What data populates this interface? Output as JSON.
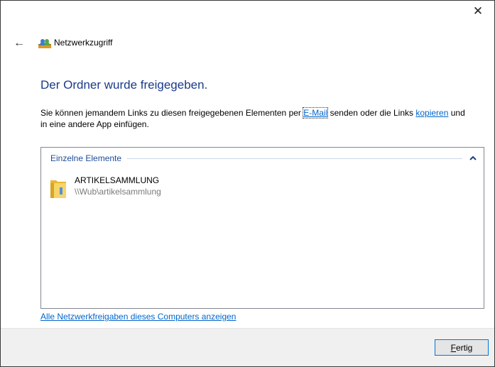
{
  "window": {
    "title": "Netzwerkzugriff",
    "close_glyph": "✕",
    "back_glyph": "←"
  },
  "main": {
    "heading": "Der Ordner wurde freigegeben.",
    "desc_part1": "Sie können jemandem Links zu diesen freigegebenen Elementen per ",
    "email_link": "E-Mail",
    "desc_part2": " senden oder die Links ",
    "copy_link": "kopieren",
    "desc_part3": " und in eine andere App einfügen."
  },
  "list": {
    "group_label": "Einzelne Elemente",
    "chevron": "⌃",
    "items": [
      {
        "name": "ARTIKELSAMMLUNG",
        "path": "\\\\Wub\\artikelsammlung",
        "icon": "folder-icon"
      }
    ]
  },
  "links": {
    "show_all": "Alle Netzwerkfreigaben dieses Computers anzeigen"
  },
  "footer": {
    "done_accel": "F",
    "done_rest": "ertig"
  },
  "colors": {
    "heading": "#1a3a8a",
    "link": "#0066cc",
    "group_label": "#1e4c9a",
    "footer_bg": "#f0f0f0",
    "button_border": "#0078d7"
  }
}
